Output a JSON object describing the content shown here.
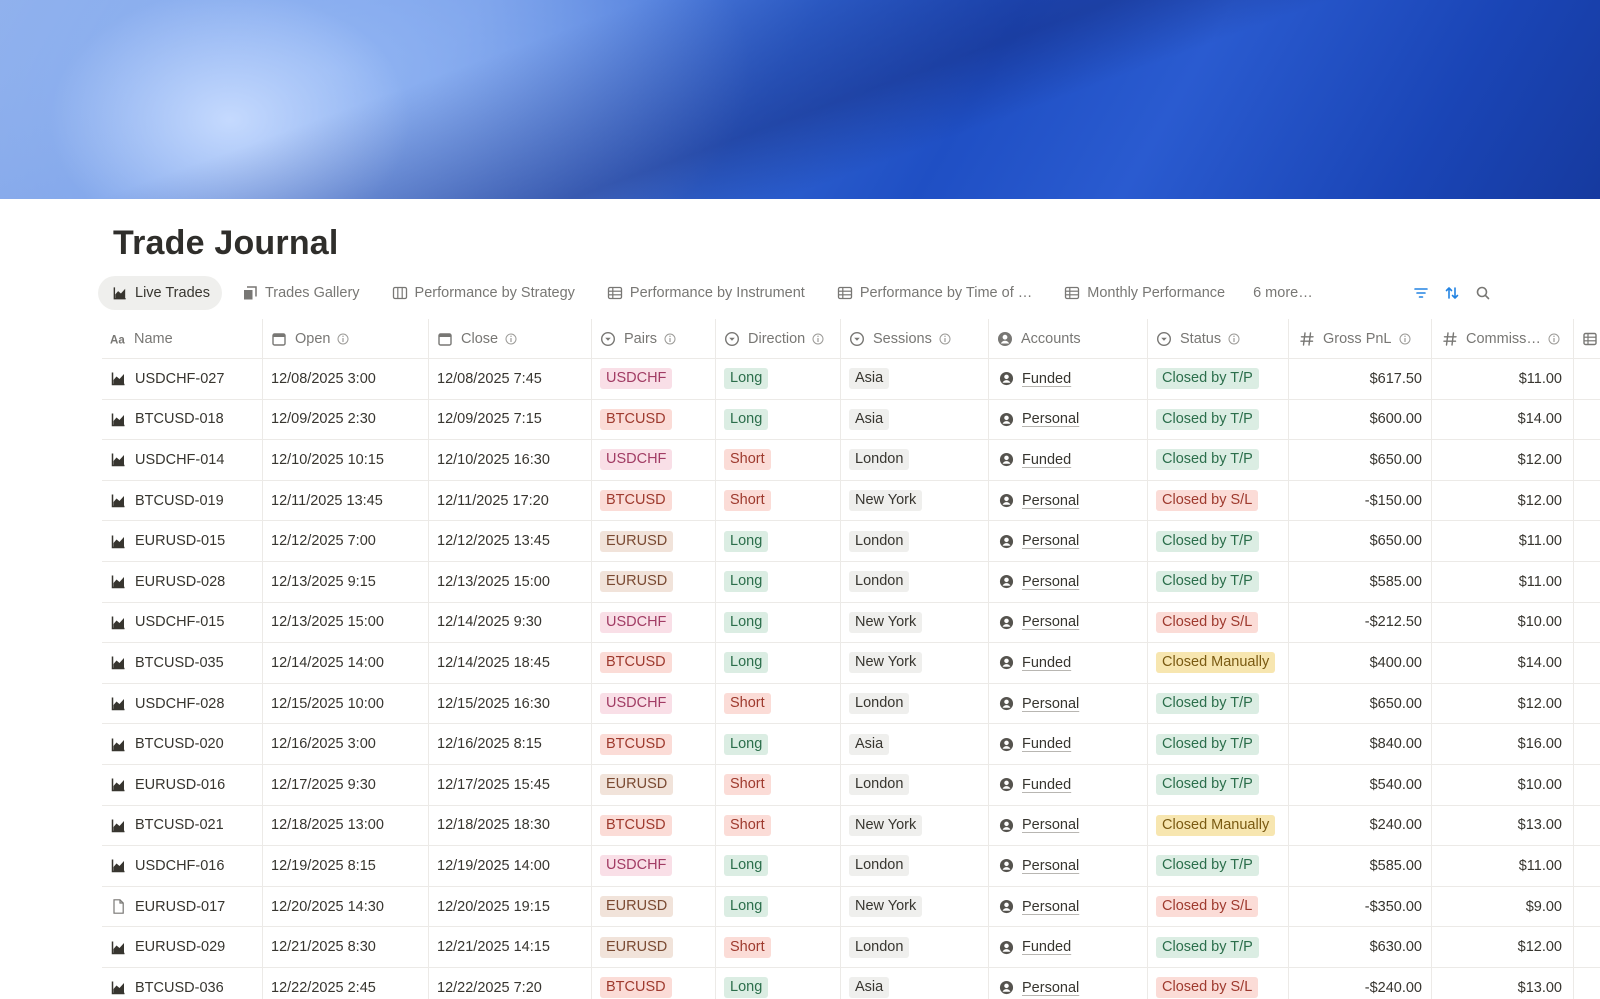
{
  "page": {
    "title": "Trade Journal"
  },
  "views": [
    {
      "label": "Live Trades",
      "icon": "chart-icon",
      "active": true
    },
    {
      "label": "Trades Gallery",
      "icon": "gallery-icon",
      "active": false
    },
    {
      "label": "Performance by Strategy",
      "icon": "board-icon",
      "active": false
    },
    {
      "label": "Performance by Instrument",
      "icon": "table-icon",
      "active": false
    },
    {
      "label": "Performance by Time of …",
      "icon": "table-icon",
      "active": false
    },
    {
      "label": "Monthly Performance",
      "icon": "table-icon",
      "active": false
    }
  ],
  "views_more": "6 more…",
  "columns": {
    "name": "Name",
    "open": "Open",
    "close": "Close",
    "pairs": "Pairs",
    "direction": "Direction",
    "sessions": "Sessions",
    "accounts": "Accounts",
    "status": "Status",
    "gross": "Gross PnL",
    "commission": "Commiss…"
  },
  "colors": {
    "accent_blue": "#2383e2",
    "pair_usdchf_bg": "#f9dfe7",
    "pair_usdchf_fg": "#a13c64",
    "pair_btcusd_bg": "#fbdcd7",
    "pair_btcusd_fg": "#9e3a2e",
    "pair_eurusd_bg": "#f1e3da",
    "pair_eurusd_fg": "#7a4a32",
    "dir_long_bg": "#dbede3",
    "dir_long_fg": "#2b6e4b",
    "dir_short_bg": "#fbdcd7",
    "dir_short_fg": "#9e3a2e",
    "session_bg": "#efefed",
    "session_fg": "#37352f",
    "status_tp_bg": "#dbede3",
    "status_tp_fg": "#2b6e4b",
    "status_sl_bg": "#fbdcd7",
    "status_sl_fg": "#9e3a2e",
    "status_manual_bg": "#f7e6b0",
    "status_manual_fg": "#7a5a12"
  },
  "rows": [
    {
      "name": "USDCHF-027",
      "icon": "chart-icon",
      "open": "12/08/2025 3:00",
      "close": "12/08/2025 7:45",
      "pair": "USDCHF",
      "direction": "Long",
      "session": "Asia",
      "account": "Funded",
      "status": "Closed by T/P",
      "gross": "$617.50",
      "commission": "$11.00"
    },
    {
      "name": "BTCUSD-018",
      "icon": "chart-icon",
      "open": "12/09/2025 2:30",
      "close": "12/09/2025 7:15",
      "pair": "BTCUSD",
      "direction": "Long",
      "session": "Asia",
      "account": "Personal",
      "status": "Closed by T/P",
      "gross": "$600.00",
      "commission": "$14.00"
    },
    {
      "name": "USDCHF-014",
      "icon": "chart-icon",
      "open": "12/10/2025 10:15",
      "close": "12/10/2025 16:30",
      "pair": "USDCHF",
      "direction": "Short",
      "session": "London",
      "account": "Funded",
      "status": "Closed by T/P",
      "gross": "$650.00",
      "commission": "$12.00"
    },
    {
      "name": "BTCUSD-019",
      "icon": "chart-icon",
      "open": "12/11/2025 13:45",
      "close": "12/11/2025 17:20",
      "pair": "BTCUSD",
      "direction": "Short",
      "session": "New York",
      "account": "Personal",
      "status": "Closed by S/L",
      "gross": "-$150.00",
      "commission": "$12.00"
    },
    {
      "name": "EURUSD-015",
      "icon": "chart-icon",
      "open": "12/12/2025 7:00",
      "close": "12/12/2025 13:45",
      "pair": "EURUSD",
      "direction": "Long",
      "session": "London",
      "account": "Personal",
      "status": "Closed by T/P",
      "gross": "$650.00",
      "commission": "$11.00"
    },
    {
      "name": "EURUSD-028",
      "icon": "chart-icon",
      "open": "12/13/2025 9:15",
      "close": "12/13/2025 15:00",
      "pair": "EURUSD",
      "direction": "Long",
      "session": "London",
      "account": "Personal",
      "status": "Closed by T/P",
      "gross": "$585.00",
      "commission": "$11.00"
    },
    {
      "name": "USDCHF-015",
      "icon": "chart-icon",
      "open": "12/13/2025 15:00",
      "close": "12/14/2025 9:30",
      "pair": "USDCHF",
      "direction": "Long",
      "session": "New York",
      "account": "Personal",
      "status": "Closed by S/L",
      "gross": "-$212.50",
      "commission": "$10.00"
    },
    {
      "name": "BTCUSD-035",
      "icon": "chart-icon",
      "open": "12/14/2025 14:00",
      "close": "12/14/2025 18:45",
      "pair": "BTCUSD",
      "direction": "Long",
      "session": "New York",
      "account": "Funded",
      "status": "Closed Manually",
      "gross": "$400.00",
      "commission": "$14.00"
    },
    {
      "name": "USDCHF-028",
      "icon": "chart-icon",
      "open": "12/15/2025 10:00",
      "close": "12/15/2025 16:30",
      "pair": "USDCHF",
      "direction": "Short",
      "session": "London",
      "account": "Personal",
      "status": "Closed by T/P",
      "gross": "$650.00",
      "commission": "$12.00"
    },
    {
      "name": "BTCUSD-020",
      "icon": "chart-icon",
      "open": "12/16/2025 3:00",
      "close": "12/16/2025 8:15",
      "pair": "BTCUSD",
      "direction": "Long",
      "session": "Asia",
      "account": "Funded",
      "status": "Closed by T/P",
      "gross": "$840.00",
      "commission": "$16.00"
    },
    {
      "name": "EURUSD-016",
      "icon": "chart-icon",
      "open": "12/17/2025 9:30",
      "close": "12/17/2025 15:45",
      "pair": "EURUSD",
      "direction": "Short",
      "session": "London",
      "account": "Funded",
      "status": "Closed by T/P",
      "gross": "$540.00",
      "commission": "$10.00"
    },
    {
      "name": "BTCUSD-021",
      "icon": "chart-icon",
      "open": "12/18/2025 13:00",
      "close": "12/18/2025 18:30",
      "pair": "BTCUSD",
      "direction": "Short",
      "session": "New York",
      "account": "Personal",
      "status": "Closed Manually",
      "gross": "$240.00",
      "commission": "$13.00"
    },
    {
      "name": "USDCHF-016",
      "icon": "chart-icon",
      "open": "12/19/2025 8:15",
      "close": "12/19/2025 14:00",
      "pair": "USDCHF",
      "direction": "Long",
      "session": "London",
      "account": "Personal",
      "status": "Closed by T/P",
      "gross": "$585.00",
      "commission": "$11.00"
    },
    {
      "name": "EURUSD-017",
      "icon": "document-icon",
      "open": "12/20/2025 14:30",
      "close": "12/20/2025 19:15",
      "pair": "EURUSD",
      "direction": "Long",
      "session": "New York",
      "account": "Personal",
      "status": "Closed by S/L",
      "gross": "-$350.00",
      "commission": "$9.00"
    },
    {
      "name": "EURUSD-029",
      "icon": "chart-icon",
      "open": "12/21/2025 8:30",
      "close": "12/21/2025 14:15",
      "pair": "EURUSD",
      "direction": "Short",
      "session": "London",
      "account": "Funded",
      "status": "Closed by T/P",
      "gross": "$630.00",
      "commission": "$12.00"
    },
    {
      "name": "BTCUSD-036",
      "icon": "chart-icon",
      "open": "12/22/2025 2:45",
      "close": "12/22/2025 7:20",
      "pair": "BTCUSD",
      "direction": "Long",
      "session": "Asia",
      "account": "Personal",
      "status": "Closed by S/L",
      "gross": "-$240.00",
      "commission": "$13.00"
    }
  ]
}
